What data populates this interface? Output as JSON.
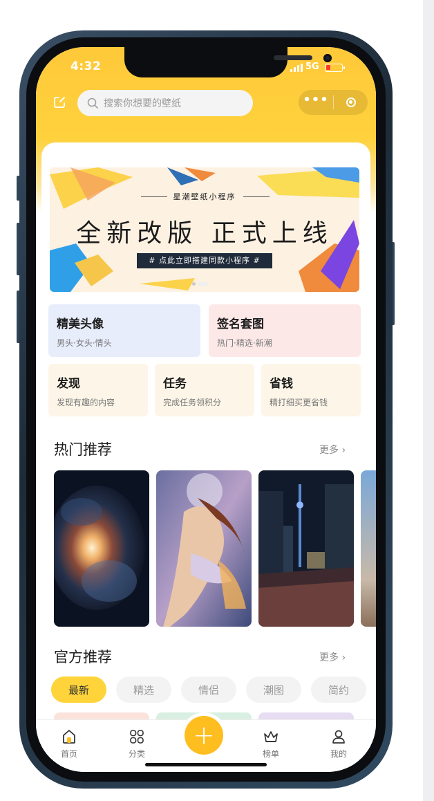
{
  "status_bar": {
    "time": "4:32",
    "network": "5G"
  },
  "header": {
    "search_placeholder": "搜索你想要的壁纸",
    "capsule_more": "•••"
  },
  "banner": {
    "subtitle": "星潮壁纸小程序",
    "title": "全新改版 正式上线",
    "tag": "#  点此立即搭建同款小程序  #"
  },
  "features_large": [
    {
      "title": "精美头像",
      "subtitle": "男头·女头·情头",
      "bg": "#e8edfc"
    },
    {
      "title": "签名套图",
      "subtitle": "热门·精选·新潮",
      "bg": "#fde8e8"
    }
  ],
  "features_small": [
    {
      "title": "发现",
      "subtitle": "发现有趣的内容"
    },
    {
      "title": "任务",
      "subtitle": "完成任务领积分"
    },
    {
      "title": "省钱",
      "subtitle": "精打细买更省钱"
    }
  ],
  "hot_section": {
    "title": "热门推荐",
    "more": "更多 ›"
  },
  "official_section": {
    "title": "官方推荐",
    "more": "更多 ›",
    "tabs": [
      "最新",
      "精选",
      "情侣",
      "潮图",
      "简约"
    ],
    "active_tab": "最新"
  },
  "tabbar": {
    "items": [
      {
        "label": "首页",
        "icon": "home-icon"
      },
      {
        "label": "分类",
        "icon": "grid-icon"
      },
      {
        "label": "",
        "icon": "plus-icon"
      },
      {
        "label": "榜单",
        "icon": "crown-icon"
      },
      {
        "label": "我的",
        "icon": "user-icon"
      }
    ]
  },
  "colors": {
    "accent": "#ffc93a",
    "fab": "#ffbe1f"
  }
}
